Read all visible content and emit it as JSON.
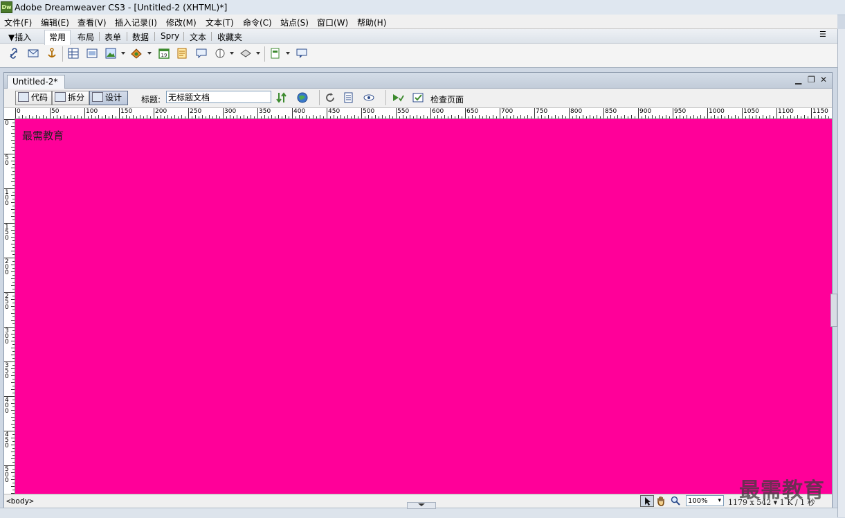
{
  "app": {
    "icon_label": "Dw",
    "window_title": "Adobe Dreamweaver CS3 - [Untitled-2 (XHTML)*]"
  },
  "menu": {
    "items": [
      "文件(F)",
      "编辑(E)",
      "查看(V)",
      "插入记录(I)",
      "修改(M)",
      "文本(T)",
      "命令(C)",
      "站点(S)",
      "窗口(W)",
      "帮助(H)"
    ]
  },
  "insert_bar": {
    "label": "▼插入",
    "tabs": [
      "常用",
      "布局",
      "表单",
      "数据",
      "Spry",
      "文本",
      "收藏夹"
    ],
    "active_tab": "常用",
    "tools": [
      "hyperlink-icon",
      "email-link-icon",
      "named-anchor-icon",
      "table-icon",
      "div-icon",
      "image-icon",
      "media-icon",
      "date-icon",
      "server-include-icon",
      "comment-icon",
      "head-icon",
      "script-icon",
      "templates-icon",
      "tag-chooser-icon"
    ]
  },
  "document": {
    "tab_label": "Untitled-2*",
    "window_controls": [
      "▁",
      "❐",
      "✕"
    ],
    "view_buttons": [
      "代码",
      "拆分",
      "设计"
    ],
    "active_view": "设计",
    "title_label": "标题:",
    "title_value": "无标题文档",
    "check_page_label": "检查页面",
    "canvas_text": "最需教育",
    "canvas_background": "#ff0099"
  },
  "rulers": {
    "horizontal_labels": [
      "0",
      "50",
      "100",
      "150",
      "200",
      "250",
      "300",
      "350",
      "400",
      "450",
      "500",
      "550",
      "600",
      "650",
      "700",
      "750",
      "800",
      "850",
      "900",
      "950",
      "1000",
      "1050",
      "1100",
      "1150"
    ],
    "vertical_labels": [
      "0",
      "50",
      "100",
      "150",
      "200",
      "250",
      "300",
      "350",
      "400",
      "450",
      "500"
    ]
  },
  "status_bar": {
    "tag_selector": "<body>",
    "zoom": "100%",
    "dimensions": "1179 x 542 ▾ 1 K / 1 秒"
  },
  "watermark": "最需教育"
}
